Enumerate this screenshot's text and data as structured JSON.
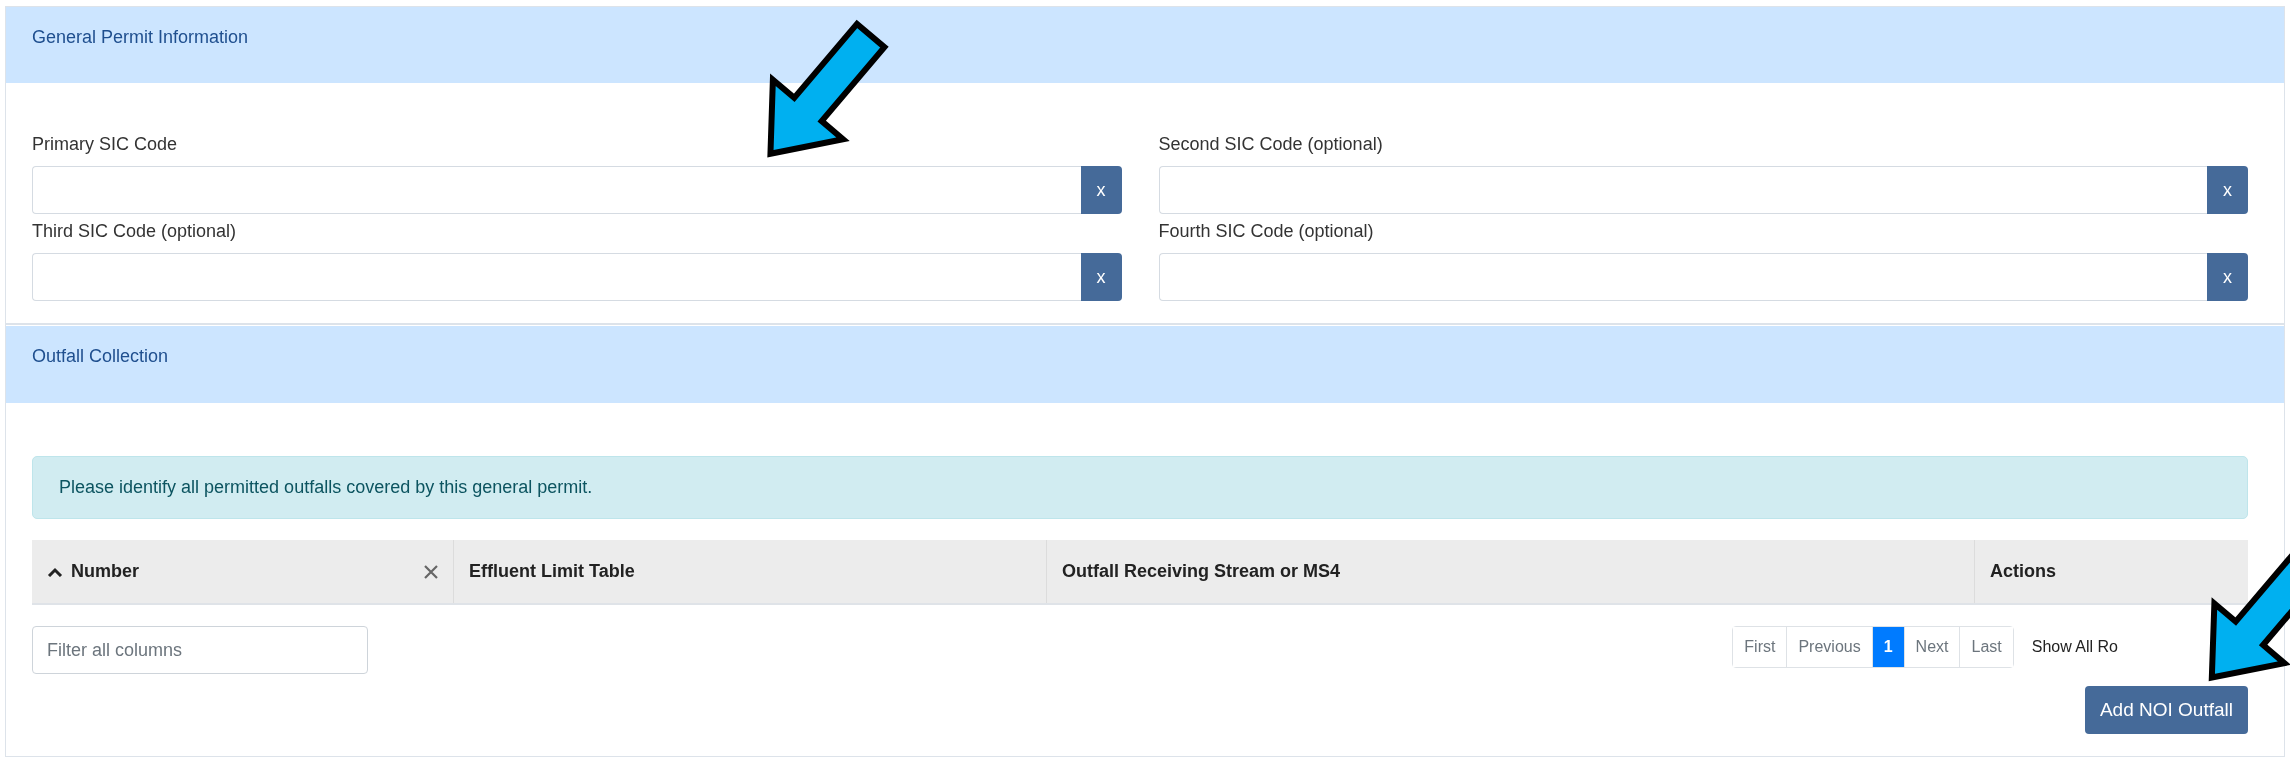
{
  "permit_panel": {
    "title": "General Permit Information",
    "fields": [
      {
        "label": "Primary SIC Code",
        "clear": "x"
      },
      {
        "label": "Second SIC Code (optional)",
        "clear": "x"
      },
      {
        "label": "Third SIC Code (optional)",
        "clear": "x"
      },
      {
        "label": "Fourth SIC Code (optional)",
        "clear": "x"
      }
    ]
  },
  "outfall_panel": {
    "title": "Outfall Collection",
    "alert": "Please identify all permitted outfalls covered by this general permit.",
    "table": {
      "columns": [
        {
          "label": "Number",
          "sorted": true,
          "clearable": true
        },
        {
          "label": "Effluent Limit Table",
          "sorted": false,
          "clearable": false
        },
        {
          "label": "Outfall Receiving Stream or MS4",
          "sorted": false,
          "clearable": false
        },
        {
          "label": "Actions",
          "sorted": false,
          "clearable": false
        }
      ]
    },
    "filter": {
      "placeholder": "Filter all columns"
    },
    "pagination": [
      {
        "label": "First",
        "selected": false
      },
      {
        "label": "Previous",
        "selected": false
      },
      {
        "label": "1",
        "selected": true
      },
      {
        "label": "Next",
        "selected": false
      },
      {
        "label": "Last",
        "selected": false
      }
    ],
    "show_all": "Show All Ro",
    "add_button": "Add NOI Outfall"
  },
  "annotations": [
    {
      "kind": "arrow"
    },
    {
      "kind": "arrow"
    }
  ]
}
